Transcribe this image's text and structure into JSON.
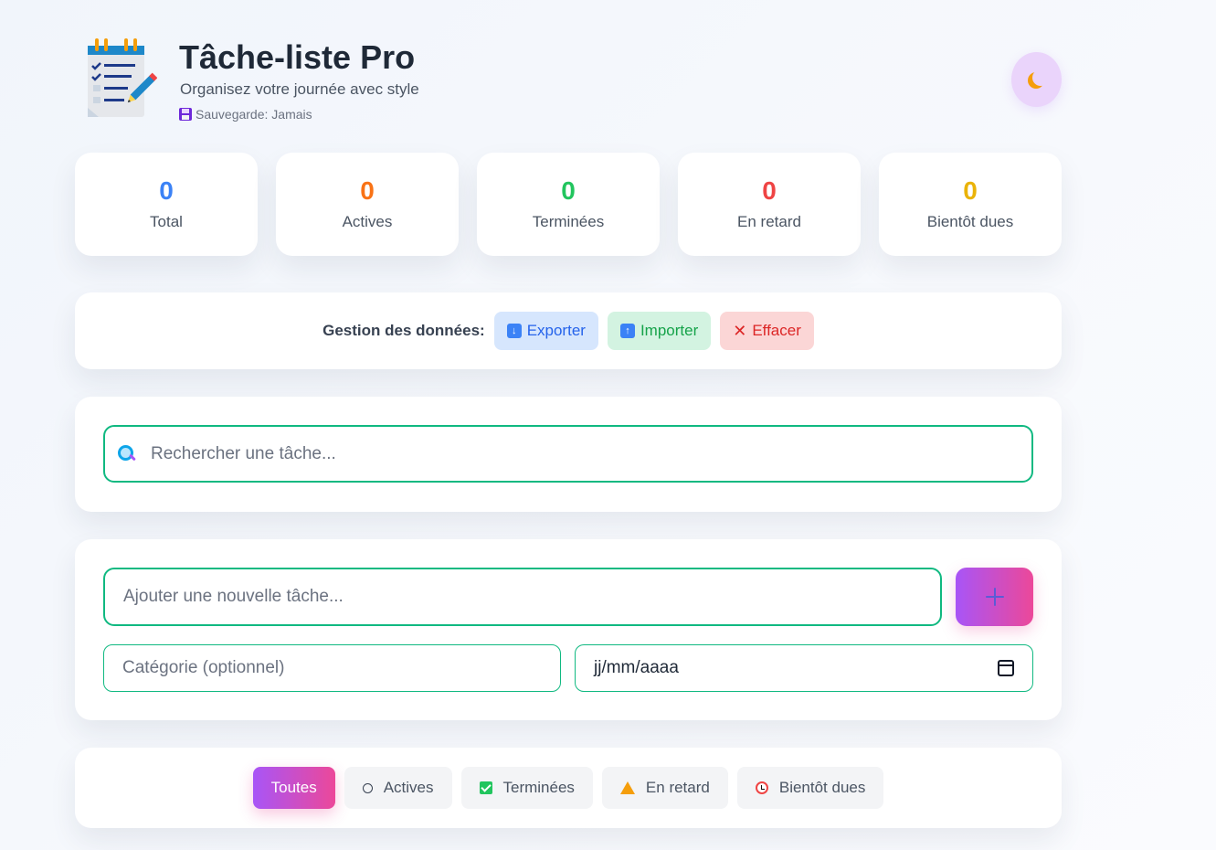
{
  "header": {
    "title": "Tâche-liste Pro",
    "subtitle": "Organisez votre journée avec style",
    "save_status": "Sauvegarde: Jamais",
    "logo_icon": "notepad-checklist-icon",
    "save_icon": "floppy-disk-icon",
    "theme_toggle_icon": "crescent-moon-icon"
  },
  "stats": [
    {
      "value": "0",
      "label": "Total",
      "color": "#3b82f6"
    },
    {
      "value": "0",
      "label": "Actives",
      "color": "#f97316"
    },
    {
      "value": "0",
      "label": "Terminées",
      "color": "#22c55e"
    },
    {
      "value": "0",
      "label": "En retard",
      "color": "#ef4444"
    },
    {
      "value": "0",
      "label": "Bientôt dues",
      "color": "#eab308"
    }
  ],
  "data_management": {
    "label": "Gestion des données:",
    "export_label": "Exporter",
    "import_label": "Importer",
    "clear_label": "Effacer"
  },
  "search": {
    "placeholder": "Rechercher une tâche..."
  },
  "add_task": {
    "task_placeholder": "Ajouter une nouvelle tâche...",
    "category_placeholder": "Catégorie (optionnel)",
    "date_placeholder": "jj/mm/aaaa",
    "add_icon": "plus-icon"
  },
  "filters": [
    {
      "label": "Toutes",
      "icon": "",
      "active": true
    },
    {
      "label": "Actives",
      "icon": "circle-icon",
      "active": false
    },
    {
      "label": "Terminées",
      "icon": "check-box-icon",
      "active": false
    },
    {
      "label": "En retard",
      "icon": "warning-icon",
      "active": false
    },
    {
      "label": "Bientôt dues",
      "icon": "alarm-clock-icon",
      "active": false
    }
  ],
  "colors": {
    "accent_gradient_start": "#a855f7",
    "accent_gradient_end": "#ec4899",
    "input_border": "#10b981"
  }
}
